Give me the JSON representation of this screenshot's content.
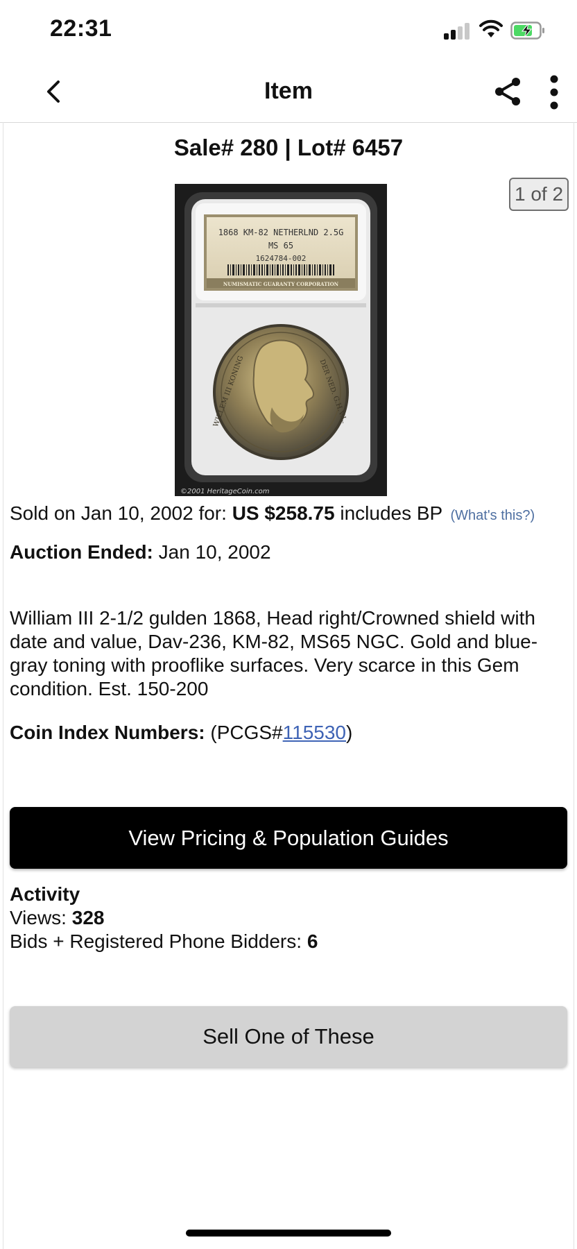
{
  "status_bar": {
    "time": "22:31",
    "icons": [
      "cellular-signal-icon",
      "wifi-icon",
      "battery-charging-icon"
    ],
    "battery_color": "#4cd964"
  },
  "nav": {
    "title": "Item",
    "back_icon": "chevron-left-icon",
    "share_icon": "share-icon",
    "more_icon": "more-vertical-icon"
  },
  "item": {
    "sale_title": "Sale# 280 | Lot# 6457",
    "photo_counter": "1 of 2",
    "photo": {
      "label_line1": "1868 KM-82 NETHERLND 2.5G",
      "label_line2": "MS 65",
      "label_line3": "1624784-002",
      "label_footer": "NUMISMATIC GUARANTY CORPORATION",
      "legend_left": "WILLEM III KONING",
      "legend_right": "DER NED. G.H.V.L.",
      "copyright": "©2001 HeritageCoin.com"
    },
    "sold": {
      "prefix": "Sold on Jan 10, 2002 for:",
      "price": "US $258.75",
      "suffix": "includes BP",
      "help_link": "(What's this?)"
    },
    "ended": {
      "label": "Auction Ended:",
      "value": "Jan 10, 2002"
    },
    "description": "William III 2-1/2 gulden 1868, Head right/Crowned shield with date and value, Dav-236, KM-82, MS65 NGC. Gold and blue-gray toning with prooflike surfaces. Very scarce in this Gem condition. Est. 150-200",
    "coin_index": {
      "label": "Coin Index Numbers:",
      "prefix": "(PCGS#",
      "pcgs_number": "115530",
      "suffix": ")"
    }
  },
  "buttons": {
    "pricing": "View Pricing & Population Guides",
    "sell": "Sell One of These"
  },
  "activity": {
    "title": "Activity",
    "views_label": "Views:",
    "views": "328",
    "bids_label": "Bids + Registered Phone Bidders:",
    "bids": "6"
  },
  "colors": {
    "link": "#3e63b5",
    "help_link": "#4e6fa1",
    "primary_button": "#000000",
    "secondary_button": "#d3d3d3"
  }
}
